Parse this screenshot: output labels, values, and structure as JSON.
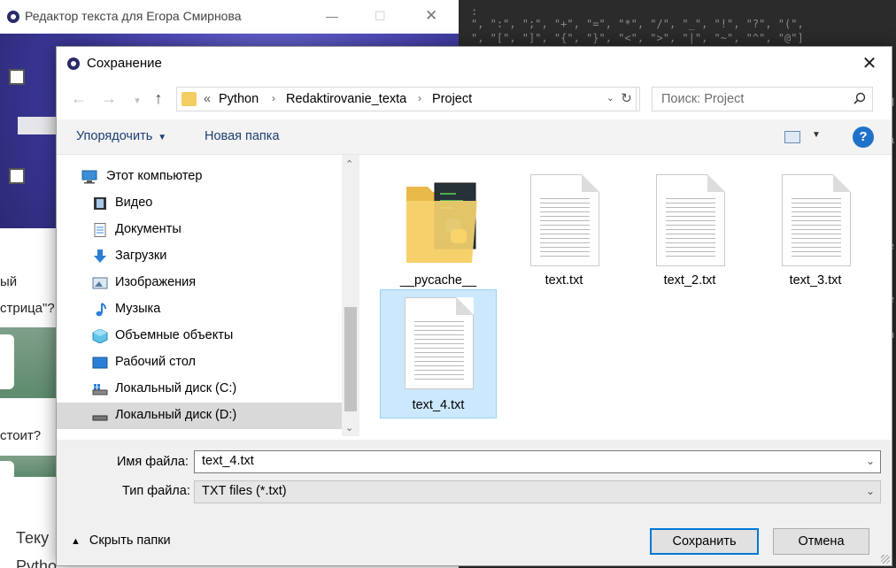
{
  "background_editor": {
    "title": "Редактор текста для Егора Смирнова",
    "side_text_1": "ый",
    "side_text_2": "стрица\"?",
    "side_text_3": "стоит?",
    "side_text_4": "Теку",
    "side_text_5": "Pytho"
  },
  "background_code": {
    "line1": ":",
    "line2": "\", \":\", \";\", \"+\", \"=\", \"*\", \"/\", \"_\", \"!\", \"?\", \"(\",",
    "line3": "\", \"[\", \"]\", \"{\", \"}\", \"<\", \">\", \"|\", \"~\", \"^\", \"@\"]",
    "right_letters": [
      "d",
      "a",
      "e",
      "e",
      "n"
    ]
  },
  "dialog": {
    "title": "Сохранение",
    "breadcrumb": {
      "prefix": "«",
      "parts": [
        "Python",
        "Redaktirovanie_texta",
        "Project"
      ]
    },
    "search_placeholder": "Поиск: Project",
    "commands": {
      "organize": "Упорядочить",
      "new_folder": "Новая папка"
    },
    "help_label": "?",
    "tree": [
      {
        "label": "Этот компьютер",
        "icon": "computer-icon"
      },
      {
        "label": "Видео",
        "icon": "video-icon"
      },
      {
        "label": "Документы",
        "icon": "documents-icon"
      },
      {
        "label": "Загрузки",
        "icon": "downloads-icon"
      },
      {
        "label": "Изображения",
        "icon": "images-icon"
      },
      {
        "label": "Музыка",
        "icon": "music-icon"
      },
      {
        "label": "Объемные объекты",
        "icon": "3d-objects-icon"
      },
      {
        "label": "Рабочий стол",
        "icon": "desktop-icon"
      },
      {
        "label": "Локальный диск (C:)",
        "icon": "drive-c-icon"
      },
      {
        "label": "Локальный диск (D:)",
        "icon": "drive-d-icon",
        "selected": true
      }
    ],
    "files": [
      {
        "name": "__pycache__",
        "type": "folder"
      },
      {
        "name": "text.txt",
        "type": "txt"
      },
      {
        "name": "text_2.txt",
        "type": "txt"
      },
      {
        "name": "text_3.txt",
        "type": "txt"
      },
      {
        "name": "text_4.txt",
        "type": "txt",
        "selected": true
      }
    ],
    "filename_label": "Имя файла:",
    "filename_value": "text_4.txt",
    "filetype_label": "Тип файла:",
    "filetype_value": "TXT files (*.txt)",
    "hide_folders": "Скрыть папки",
    "save_button": "Сохранить",
    "cancel_button": "Отмена",
    "colors": {
      "accent": "#0078d7",
      "selection": "#cce8ff",
      "link": "#1a3e74"
    }
  }
}
